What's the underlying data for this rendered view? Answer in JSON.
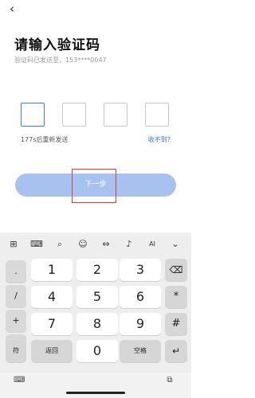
{
  "nav": {
    "back_icon": "‹"
  },
  "title": "请输入验证码",
  "subtitle": "验证码已发送至，153****0047",
  "code": {
    "boxes": [
      "",
      "",
      "",
      ""
    ],
    "active_index": 0
  },
  "resend_label": "177s后重新发送",
  "not_received_label": "收不到?",
  "next_label": "下一步",
  "colors": {
    "accent": "#3c7be8",
    "button_bg": "#a8c2ef",
    "highlight": "#e23a3a"
  },
  "keyboard": {
    "toolbar": [
      {
        "icon": "app-grid-icon",
        "glyph": "⊞"
      },
      {
        "icon": "keyboard-icon",
        "glyph": "⌨"
      },
      {
        "icon": "search-icon",
        "glyph": "⌕"
      },
      {
        "icon": "emoji-icon",
        "glyph": "☺"
      },
      {
        "icon": "cursor-icon",
        "glyph": "⇔"
      },
      {
        "icon": "microphone-icon",
        "glyph": "♪"
      },
      {
        "icon": "ai-icon",
        "glyph": "AI"
      },
      {
        "icon": "collapse-icon",
        "glyph": "⌄"
      }
    ],
    "side_keys": [
      ".",
      "/",
      "+",
      "-"
    ],
    "digits": [
      "1",
      "2",
      "3",
      "4",
      "5",
      "6",
      "7",
      "8",
      "9"
    ],
    "right_keys": [
      "⌫",
      "*",
      "#"
    ],
    "bottom": {
      "symbols": "符",
      "back": "返回",
      "zero": "0",
      "space": "空格",
      "enter": "↵"
    },
    "bottom_bar": {
      "left_icon": "⌨",
      "right_icon": "⧉"
    }
  }
}
